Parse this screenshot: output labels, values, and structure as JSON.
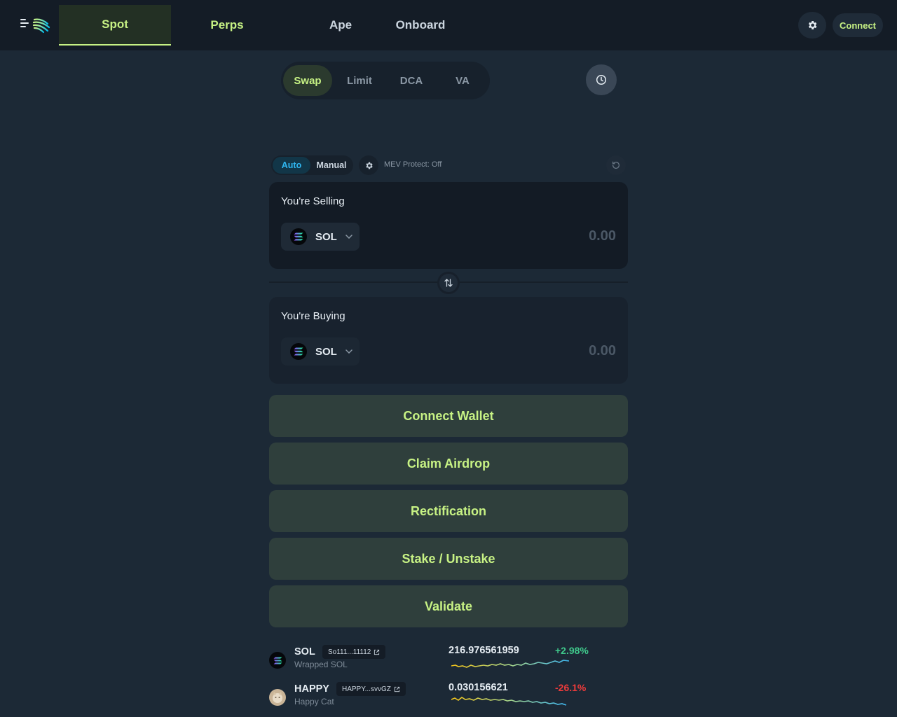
{
  "nav": {
    "tabs": [
      {
        "label": "Spot",
        "active": true
      },
      {
        "label": "Perps",
        "active": false
      },
      {
        "label": "Ape",
        "active": false
      },
      {
        "label": "Onboard",
        "active": false
      }
    ],
    "connect_label": "Connect"
  },
  "mode_tabs": [
    {
      "label": "Swap",
      "active": true
    },
    {
      "label": "Limit",
      "active": false
    },
    {
      "label": "DCA",
      "active": false
    },
    {
      "label": "VA",
      "active": false
    }
  ],
  "route": {
    "auto_label": "Auto",
    "manual_label": "Manual",
    "selected": "Auto",
    "mev_label": "MEV Protect: Off"
  },
  "sell": {
    "label": "You're Selling",
    "token": "SOL",
    "amount": "0.00"
  },
  "buy": {
    "label": "You're Buying",
    "token": "SOL",
    "amount": "0.00"
  },
  "actions": [
    "Connect Wallet",
    "Claim Airdrop",
    "Rectification",
    "Stake / Unstake",
    "Validate"
  ],
  "tokens": [
    {
      "symbol": "SOL",
      "address": "So111...11112",
      "name": "Wrapped SOL",
      "price": "216.976561959",
      "change": "+2.98%",
      "change_color": "#3fc78b"
    },
    {
      "symbol": "HAPPY",
      "address": "HAPPY...svvGZ",
      "name": "Happy Cat",
      "price": "0.030156621",
      "change": "-26.1%",
      "change_color": "#ef3b3b"
    }
  ],
  "colors": {
    "accent": "#c7f284",
    "background": "#1c2936",
    "topbar": "#141c26",
    "auto_blue": "#2fb6f0"
  }
}
